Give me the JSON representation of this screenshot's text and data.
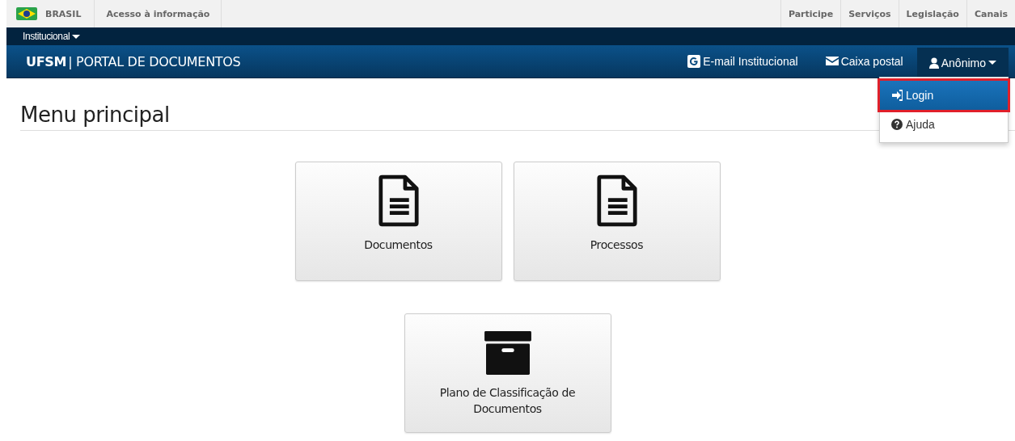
{
  "gov_bar": {
    "country": "BRASIL",
    "left_links": [
      "Acesso à informação"
    ],
    "right_links": [
      "Participe",
      "Serviços",
      "Legislação",
      "Canais"
    ]
  },
  "institutional_menu": {
    "label": "Institucional"
  },
  "header": {
    "brand": "UFSM",
    "separator": "|",
    "title": "PORTAL DE DOCUMENTOS",
    "links": [
      {
        "kind": "google",
        "label": "E-mail Institucional"
      },
      {
        "kind": "mail",
        "label": "Caixa postal"
      }
    ],
    "user_menu": {
      "label": "Anônimo",
      "expanded": true,
      "items": [
        {
          "kind": "login",
          "label": "Login",
          "selected": true,
          "highlighted": true
        },
        {
          "kind": "help",
          "label": "Ajuda",
          "selected": false,
          "highlighted": false
        }
      ]
    }
  },
  "page_title": "Menu principal",
  "tiles": [
    {
      "kind": "document",
      "label": "Documentos"
    },
    {
      "kind": "document",
      "label": "Processos"
    },
    {
      "kind": "archive",
      "label": "Plano de Classificação de Documentos"
    }
  ]
}
